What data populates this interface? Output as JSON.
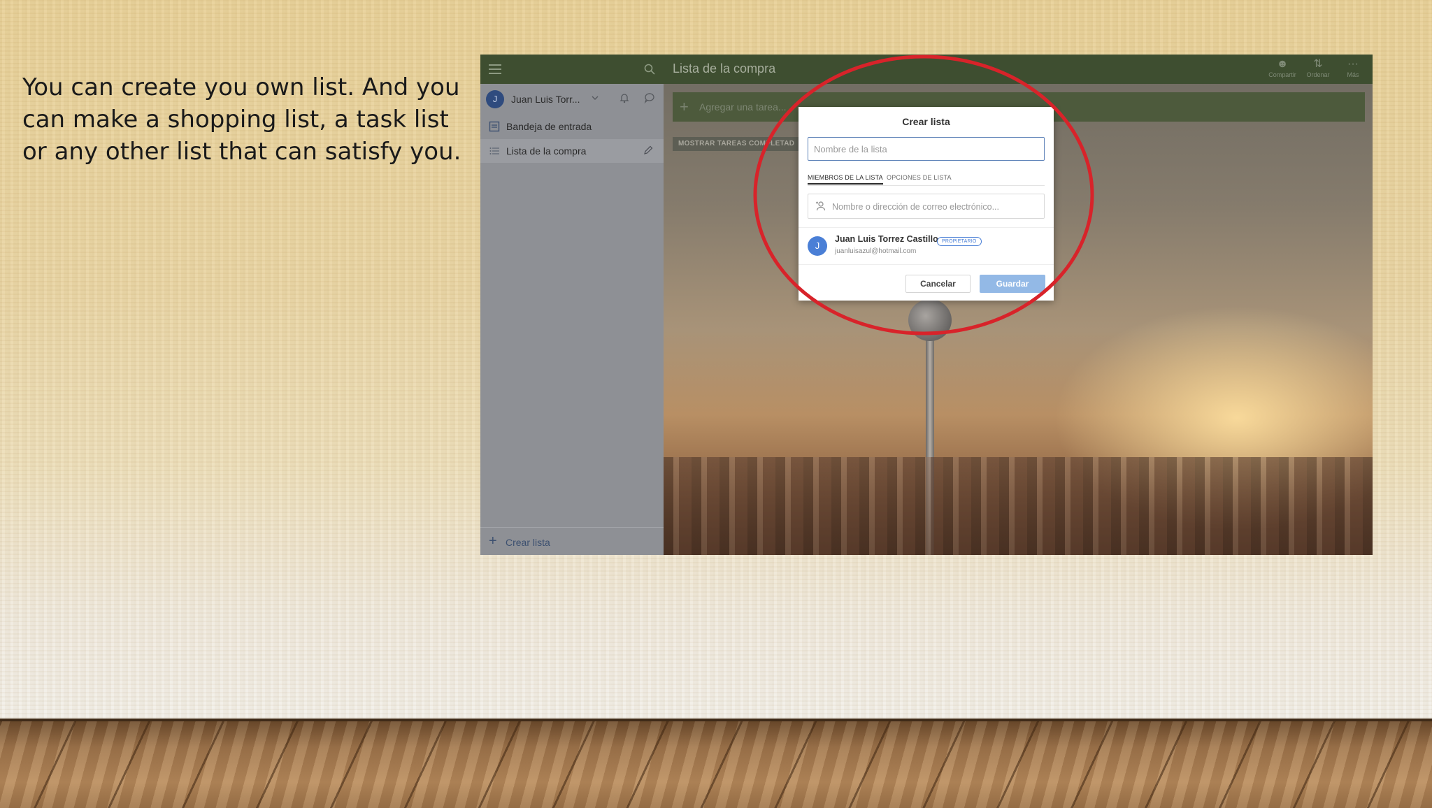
{
  "slide": {
    "body_text": "You can create you own list. And you can make a shopping list, a task list or any other list that can satisfy you."
  },
  "app": {
    "sidebar": {
      "user_initial": "J",
      "user_name": "Juan Luis Torr...",
      "items": [
        {
          "label": "Bandeja de entrada",
          "icon": "inbox-icon"
        },
        {
          "label": "Lista de la compra",
          "icon": "list-icon"
        }
      ],
      "create_list_label": "Crear lista"
    },
    "header": {
      "title": "Lista de la compra",
      "actions": [
        {
          "label": "Compartir",
          "icon": "share-user-icon"
        },
        {
          "label": "Ordenar",
          "icon": "sort-icon"
        },
        {
          "label": "Más",
          "icon": "more-dots-icon"
        }
      ]
    },
    "main": {
      "add_task_placeholder": "Agregar una tarea...",
      "show_completed_label": "MOSTRAR TAREAS COMPLETAD"
    }
  },
  "modal": {
    "title": "Crear lista",
    "name_placeholder": "Nombre de la lista",
    "name_value": "",
    "tabs": [
      {
        "label": "MIEMBROS DE LA LISTA",
        "active": true
      },
      {
        "label": "OPCIONES DE LISTA",
        "active": false
      }
    ],
    "member_search_placeholder": "Nombre o dirección de correo electrónico...",
    "member": {
      "initial": "J",
      "name": "Juan Luis Torrez Castillo",
      "badge": "PROPIETARIO",
      "email": "juanluisazul@hotmail.com"
    },
    "cancel_label": "Cancelar",
    "save_label": "Guardar"
  },
  "colors": {
    "header_green": "#3e4e30",
    "accent_blue": "#4a7fd6",
    "highlight_red": "#d8232a"
  }
}
